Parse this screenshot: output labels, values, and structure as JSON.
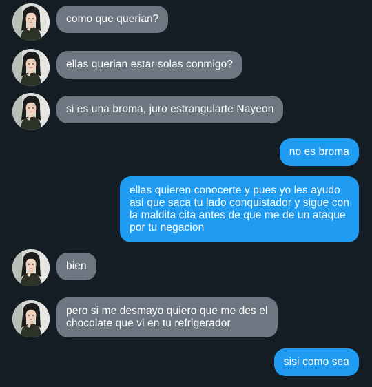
{
  "conversation": {
    "contact_avatar": "profile-photo",
    "colors": {
      "background": "#141c24",
      "incoming_bubble": "#6d7781",
      "outgoing_bubble": "#1f9cf2",
      "text": "#ffffff"
    },
    "messages": [
      {
        "direction": "incoming",
        "text": "como que querian?"
      },
      {
        "direction": "incoming",
        "text": "ellas querian estar solas conmigo?"
      },
      {
        "direction": "incoming",
        "text": "si es una broma, juro estrangularte Nayeon"
      },
      {
        "direction": "outgoing",
        "text": "no es broma"
      },
      {
        "direction": "outgoing",
        "text": "ellas quieren conocerte y pues yo les ayudo\nasí que saca tu lado conquistador y sigue con\nla maldita cita antes de que me de un ataque\npor tu negacion"
      },
      {
        "direction": "incoming",
        "text": "bien"
      },
      {
        "direction": "incoming",
        "text": "pero si me desmayo quiero que me des el\nchocolate que vi en tu refrigerador"
      },
      {
        "direction": "outgoing",
        "text": "sisi como sea"
      }
    ]
  }
}
